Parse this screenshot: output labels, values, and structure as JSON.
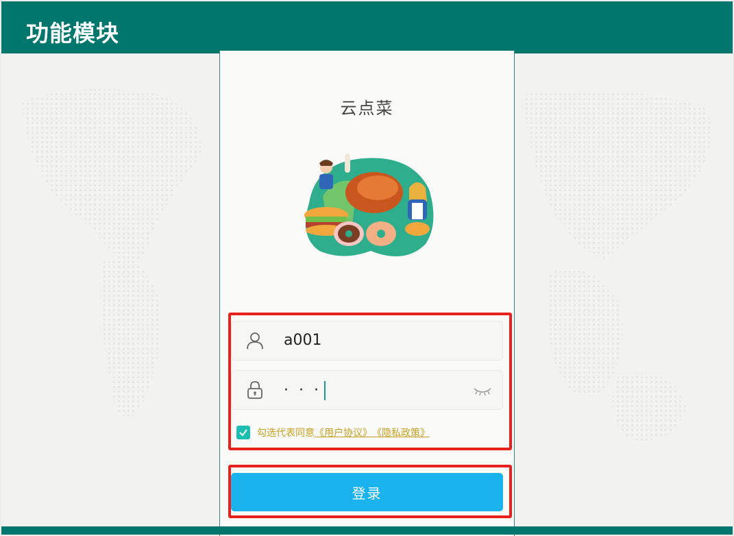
{
  "header": {
    "title": "功能模块"
  },
  "app": {
    "title": "云点菜"
  },
  "login": {
    "username_value": "a001",
    "password_value": "· · ·",
    "agreement_prefix": "勾选代表同意",
    "user_agreement": "《用户协议》",
    "privacy_policy": "《隐私政策》",
    "agreement_checked": true,
    "submit_label": "登录"
  },
  "icons": {
    "username": "user-icon",
    "password": "lock-icon",
    "toggle_visibility": "eye-closed-icon",
    "checkbox": "check-icon"
  },
  "colors": {
    "header": "#00766c",
    "button": "#1ab3ee",
    "checkbox": "#1bbfb2",
    "highlight": "#e8211d",
    "agreement_text": "#c8a020"
  }
}
